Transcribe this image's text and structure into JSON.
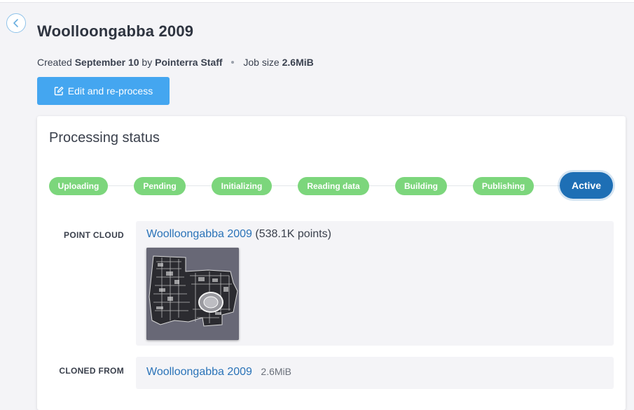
{
  "header": {
    "title": "Woolloongabba 2009",
    "meta": {
      "created_prefix": "Created",
      "created_date": "September 10",
      "by_word": "by",
      "author": "Pointerra Staff",
      "job_size_label": "Job size",
      "job_size_value": "2.6MiB"
    },
    "edit_button_label": "Edit and re-process"
  },
  "status_card": {
    "title": "Processing status",
    "steps": [
      {
        "label": "Uploading",
        "state": "done"
      },
      {
        "label": "Pending",
        "state": "done"
      },
      {
        "label": "Initializing",
        "state": "done"
      },
      {
        "label": "Reading data",
        "state": "done"
      },
      {
        "label": "Building",
        "state": "done"
      },
      {
        "label": "Publishing",
        "state": "done"
      },
      {
        "label": "Active",
        "state": "active"
      }
    ],
    "point_cloud": {
      "label": "POINT CLOUD",
      "name": "Woolloongabba 2009",
      "count": "(538.1K points)"
    },
    "cloned_from": {
      "label": "CLONED FROM",
      "name": "Woolloongabba 2009",
      "size": "2.6MiB"
    }
  },
  "colors": {
    "accent": "#44a6f0",
    "step_done": "#7cd67c",
    "step_active": "#1e6fb5",
    "link": "#2a73b8"
  }
}
